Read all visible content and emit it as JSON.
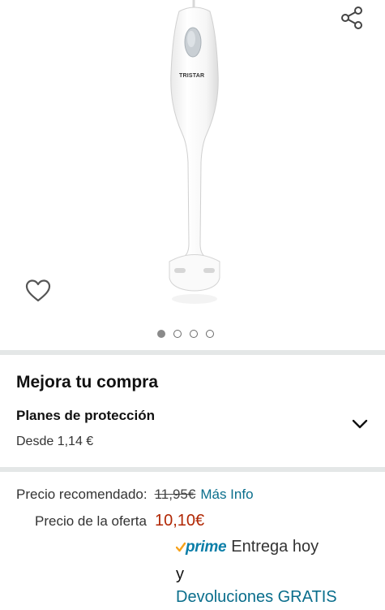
{
  "product": {
    "brand_text": "TRISTAR",
    "image_alt": "Batidora de mano Tristar blanca"
  },
  "icons": {
    "share": "share-icon",
    "wishlist": "heart-icon",
    "expand": "chevron-down-icon",
    "prime_check": "check-icon"
  },
  "carousel": {
    "count": 4,
    "active_index": 0
  },
  "upgrade": {
    "title": "Mejora tu compra",
    "plan_title": "Planes de protección",
    "plan_price": "Desde 1,14 €"
  },
  "pricing": {
    "recommended_label": "Precio recomendado:",
    "recommended_value": "11,95€",
    "more_info": "Más Info",
    "offer_label": "Precio de la oferta",
    "offer_value": "10,10€",
    "prime_label": "prime",
    "delivery": "Entrega hoy",
    "conjunction": "y",
    "returns": "Devoluciones GRATIS"
  },
  "colors": {
    "offer_price": "#b12704",
    "link": "#0a6e8c",
    "prime_blue": "#0a7ea8",
    "prime_check": "#f7a21b",
    "separator": "#e4e7e7"
  }
}
